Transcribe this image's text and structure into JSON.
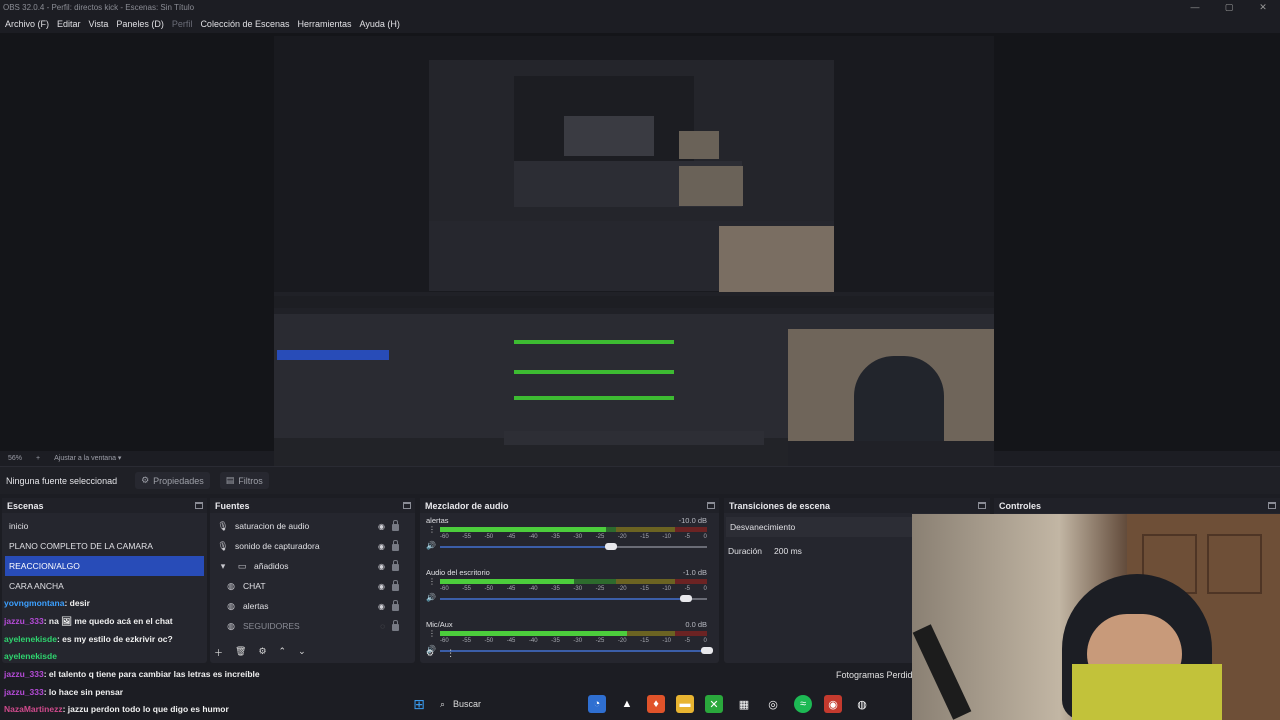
{
  "window": {
    "title": "OBS 32.0.4 - Perfil: directos kick - Escenas: Sin Título",
    "controls": [
      "—",
      "▢",
      "✕"
    ]
  },
  "menu": [
    "Archivo (F)",
    "Editar",
    "Vista",
    "Paneles (D)",
    "Perfil",
    "Colección de Escenas",
    "Herramientas",
    "Ayuda (H)"
  ],
  "zoombar": {
    "zoom": "56%",
    "plus": "+",
    "fit": "Ajustar a la ventana"
  },
  "context": {
    "no_source": "Ninguna fuente seleccionad",
    "properties": "Propiedades",
    "filters": "Filtros"
  },
  "scenes": {
    "title": "Escenas",
    "items": [
      "inicio",
      "PLANO COMPLETO DE LA CAMARA",
      "REACCION/ALGO",
      "CARA ANCHA"
    ],
    "selected_index": 2
  },
  "sources": {
    "title": "Fuentes",
    "items": [
      {
        "label": "saturacion de audio",
        "icon": "mic-icon"
      },
      {
        "label": "sonido de capturadora",
        "icon": "mic-icon"
      },
      {
        "label": "añadidos",
        "icon": "folder-icon"
      },
      {
        "label": "CHAT",
        "icon": "globe-icon"
      },
      {
        "label": "alertas",
        "icon": "globe-icon"
      },
      {
        "label": "SEGUIDORES",
        "icon": "globe-icon"
      }
    ]
  },
  "mixer": {
    "title": "Mezclador de audio",
    "tracks": [
      {
        "name": "alertas",
        "db": "-10.0 dB",
        "level": 0.62,
        "volume": 0.64
      },
      {
        "name": "Audio del escritorio",
        "db": "-1.0 dB",
        "level": 0.5,
        "volume": 0.92
      },
      {
        "name": "Mic/Aux",
        "db": "0.0 dB",
        "level": 0.7,
        "volume": 1.0
      }
    ],
    "ticks": [
      "-60",
      "-55",
      "-50",
      "-45",
      "-40",
      "-35",
      "-30",
      "-25",
      "-20",
      "-15",
      "-10",
      "-5",
      "0"
    ]
  },
  "transitions": {
    "title": "Transiciones de escena",
    "selected": "Desvanecimiento",
    "duration_label": "Duración",
    "duration_value": "200 ms"
  },
  "controls": {
    "title": "Controles"
  },
  "dropped_frames": "Fotogramas Perdid",
  "chat": [
    {
      "user": "yovngmontana",
      "text": ": desir",
      "color": "#3ca0ff"
    },
    {
      "user": "jazzu_333",
      "text": ": na 🖼 me quedo acá en el chat",
      "color": "#b44bd6"
    },
    {
      "user": "ayelenekisde",
      "text": ": es my estilo de ezkrivir oc?",
      "color": "#2fd46f"
    },
    {
      "user": "ayelenekisde",
      "text": "",
      "color": "#2fd46f"
    },
    {
      "user": "jazzu_333",
      "text": ": el talento q tiene para cambiar las letras es increíble",
      "color": "#b44bd6"
    },
    {
      "user": "jazzu_333",
      "text": ": lo hace sin pensar",
      "color": "#b44bd6"
    },
    {
      "user": "NazaMartinezz",
      "text": ": jazzu perdon todo lo que digo es humor",
      "color": "#d04a8c"
    }
  ],
  "taskbar": {
    "search": "Buscar"
  }
}
